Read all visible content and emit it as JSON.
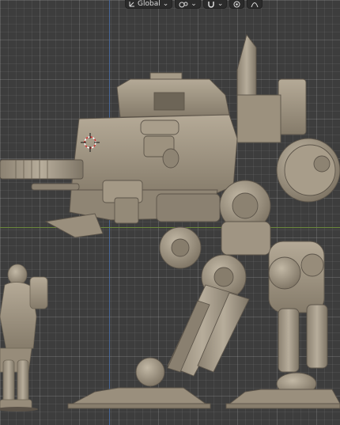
{
  "header": {
    "transform_orientation": "Global",
    "pivot_icon": "pivot-point-icon",
    "snap_icon": "snap-magnet-icon",
    "proportional_icon": "proportional-editing-icon",
    "falloff_icon": "falloff-curve-icon"
  },
  "viewport": {
    "background": "#3d3d3d",
    "model_color": "#9a8f7d",
    "axis_colors": {
      "z": "#4a6fa8",
      "y": "#6f8f3a"
    }
  }
}
